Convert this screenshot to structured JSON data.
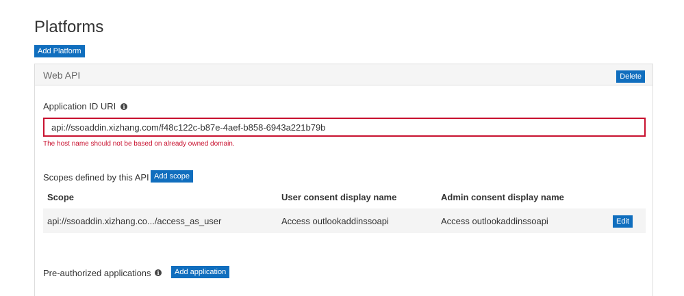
{
  "page": {
    "title": "Platforms",
    "add_platform_label": "Add Platform"
  },
  "web_api": {
    "title": "Web API",
    "delete_label": "Delete",
    "app_id_uri": {
      "label": "Application ID URI",
      "info_icon": "info-icon",
      "value": "api://ssoaddin.xizhang.com/f48c122c-b87e-4aef-b858-6943a221b79b",
      "error": "The host name should not be based on already owned domain."
    },
    "scopes": {
      "label": "Scopes defined by this API",
      "add_scope_label": "Add scope",
      "columns": [
        "Scope",
        "User consent display name",
        "Admin consent display name"
      ],
      "rows": [
        {
          "scope": "api://ssoaddin.xizhang.co.../access_as_user",
          "user_consent": "Access outlookaddinssoapi",
          "admin_consent": "Access outlookaddinssoapi",
          "edit_label": "Edit"
        }
      ]
    },
    "preauthorized": {
      "label": "Pre-authorized applications",
      "add_application_label": "Add application"
    }
  },
  "colors": {
    "accent": "#106ebe",
    "error": "#c8102e",
    "panel_header": "#f5f5f5",
    "row_background": "#f4f4f4"
  }
}
